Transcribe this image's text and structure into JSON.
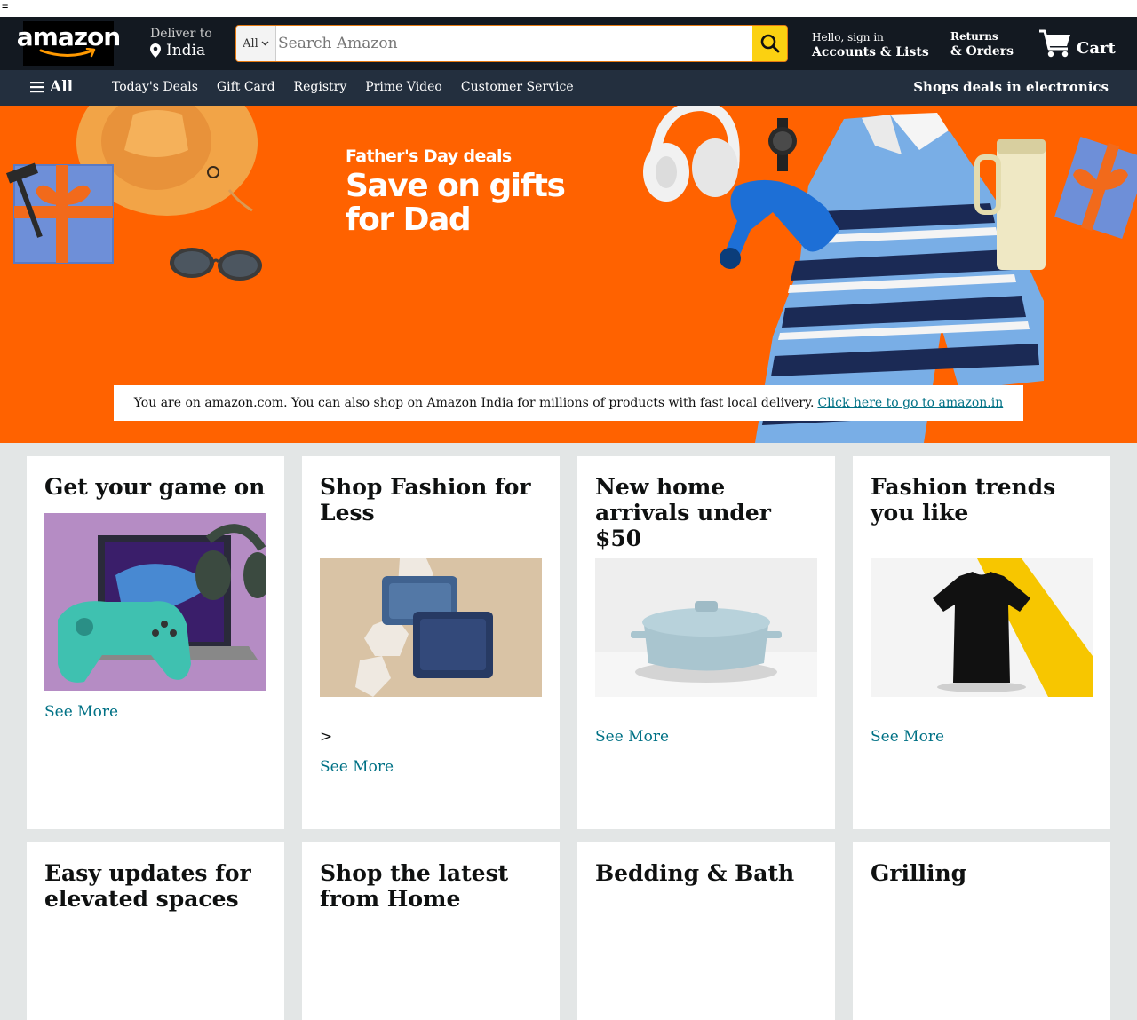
{
  "top_strip_glyph": "=",
  "logo": {
    "text": "amazon"
  },
  "deliver": {
    "line1": "Deliver to",
    "line2": "India"
  },
  "search": {
    "category": "All",
    "placeholder": "Search Amazon"
  },
  "account": {
    "line1": "Hello, sign in",
    "line2": "Accounts & Lists"
  },
  "returns": {
    "line1": "Returns",
    "line2": "& Orders"
  },
  "cart": {
    "label": "Cart"
  },
  "subnav": {
    "all_label": "All",
    "links": [
      "Today's Deals",
      "Gift Card",
      "Registry",
      "Prime Video",
      "Customer Service"
    ],
    "promo": "Shops deals in electronics"
  },
  "hero": {
    "eyebrow": "Father's Day deals",
    "headline": "Save on gifts for Dad"
  },
  "notice": {
    "text": "You are on amazon.com. You can also shop on Amazon India for millions of products with fast local delivery.",
    "link": "Click here to go to amazon.in"
  },
  "cards": [
    {
      "title": "Get your game on",
      "see_more": "See More"
    },
    {
      "title": "Shop Fashion for Less",
      "arrow": ">",
      "see_more": "See More"
    },
    {
      "title": "New home arrivals under $50",
      "see_more": "See More"
    },
    {
      "title": "Fashion trends you like",
      "see_more": "See More"
    },
    {
      "title": "Easy updates for elevated spaces"
    },
    {
      "title": "Shop the latest from Home"
    },
    {
      "title": "Bedding & Bath"
    },
    {
      "title": "Grilling"
    }
  ],
  "colors": {
    "nav_dark": "#131921",
    "subnav": "#232f3e",
    "hero_orange": "#ff6200",
    "search_button": "#fbd111",
    "link_teal": "#007185",
    "page_bg": "#e3e6e6"
  }
}
